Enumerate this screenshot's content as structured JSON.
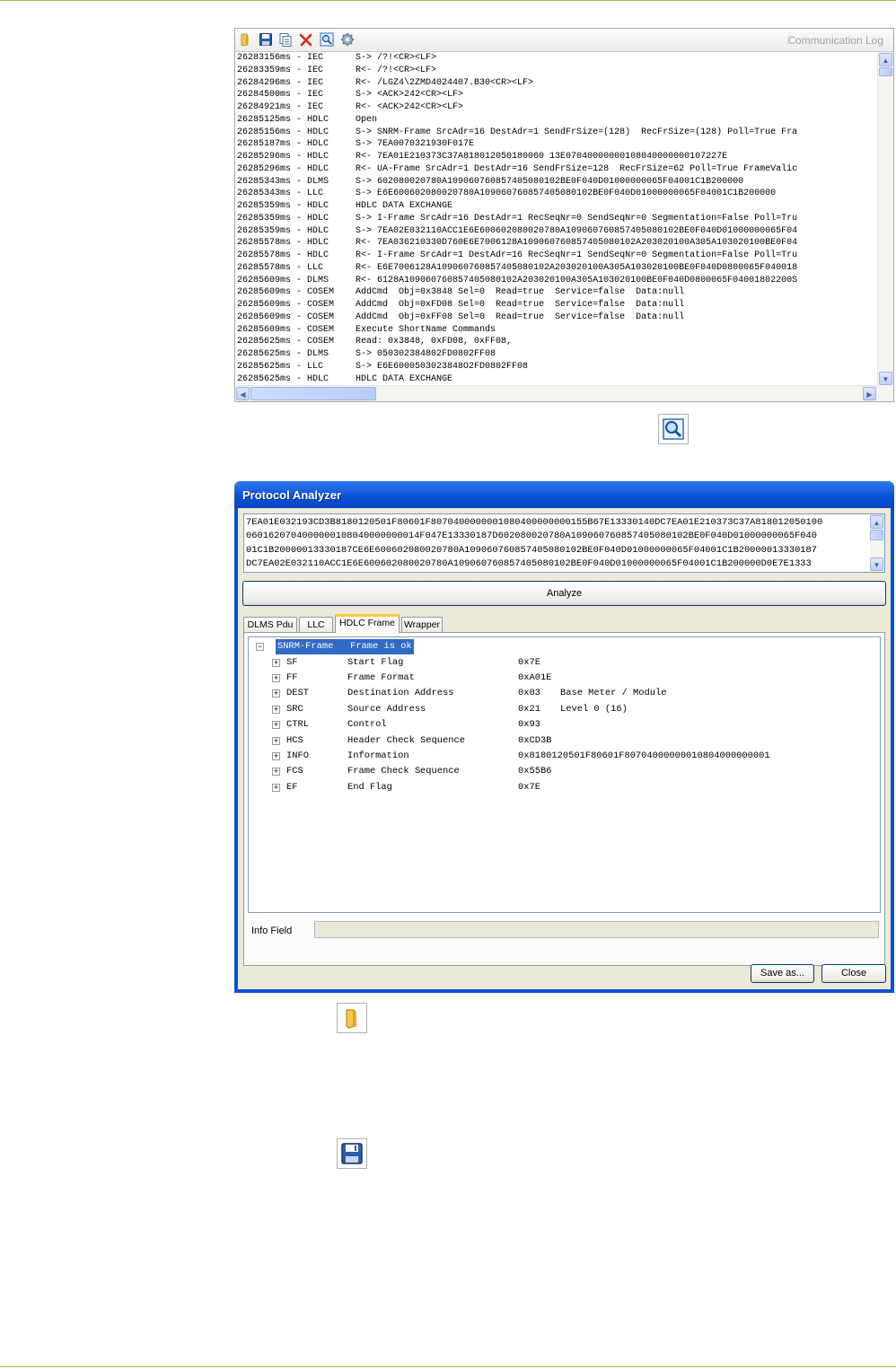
{
  "comm_log": {
    "title": "Communication Log",
    "toolbar_icons": [
      "open-folder-icon",
      "save-icon",
      "copy-icon",
      "delete-icon",
      "protocol-analyzer-icon",
      "settings-icon"
    ],
    "lines": [
      "26283156ms - IEC      S-> /?!<CR><LF>",
      "26283359ms - IEC      R<- /?!<CR><LF>",
      "26284296ms - IEC      R<- /LGZ4\\2ZMD4024407.B30<CR><LF>",
      "26284500ms - IEC      S-> <ACK>242<CR><LF>",
      "26284921ms - IEC      R<- <ACK>242<CR><LF>",
      "26285125ms - HDLC     Open",
      "26285156ms - HDLC     S-> SNRM-Frame SrcAdr=16 DestAdr=1 SendFrSize=(128)  RecFrSize=(128) Poll=True Fra",
      "26285187ms - HDLC     S-> 7EA0070321930F017E",
      "26285296ms - HDLC     R<- 7EA01E210373C37A818012050180060 13E07040000000108040000000107227E",
      "26285296ms - HDLC     R<- UA-Frame SrcAdr=1 DestAdr=16 SendFrSize=128  RecFrSize=62 Poll=True FrameValic",
      "26285343ms - DLMS     S-> 602080020780A109060760857405080102BE0F040D01000000065F04001C1B200000",
      "26285343ms - LLC      S-> E6E600602080020780A109060760857405080102BE0F040D01000000065F04001C1B200000",
      "26285359ms - HDLC     HDLC DATA EXCHANGE",
      "26285359ms - HDLC     S-> I-Frame SrcAdr=16 DestAdr=1 RecSeqNr=0 SendSeqNr=0 Segmentation=False Poll=Tru",
      "26285359ms - HDLC     S-> 7EA02E032110ACC1E6E600602080020780A109060760857405080102BE0F040D01000000065F04",
      "26285578ms - HDLC     R<- 7EA036210330D760E6E7006128A109060760857405080102A203020100A305A103020100BE0F04",
      "26285578ms - HDLC     R<- I-Frame SrcAdr=1 DestAdr=16 RecSeqNr=1 SendSeqNr=0 Segmentation=False Poll=Tru",
      "26285578ms - LLC      R<- E6E7006128A109060760857405080102A203020100A305A103020100BE0F040D0800065F040018",
      "26285609ms - DLMS     R<- 6128A109060760857405080102A203020100A305A103020100BE0F040D0800065F04001802200S",
      "26285609ms - COSEM    AddCmd  Obj=0x3848 Sel=0  Read=true  Service=false  Data:null",
      "26285609ms - COSEM    AddCmd  Obj=0xFD08 Sel=0  Read=true  Service=false  Data:null",
      "26285609ms - COSEM    AddCmd  Obj=0xFF08 Sel=0  Read=true  Service=false  Data:null",
      "26285609ms - COSEM    Execute ShortName Commands",
      "26285625ms - COSEM    Read: 0x3848, 0xFD08, 0xFF08,",
      "26285625ms - DLMS     S-> 050302384802FD0802FF08",
      "26285625ms - LLC      S-> E6E6000503023848O2FD0802FF08",
      "26285625ms - HDLC     HDLC DATA EXCHANGE"
    ]
  },
  "protocol_analyzer": {
    "title": "Protocol Analyzer",
    "hex_lines": [
      "7EA01E032193CD3B8180120501F80601F8070400000001080400000000155B67E13330140DC7EA01E210373C37A818012050100",
      "0601620704000000108040000000014F047E13330187D602080020780A109060760857405080102BE0F040D01000000065F040",
      "01C1B20000013330187CE6E600602080020780A109060760857405080102BE0F040D01000000065F04001C1B20000013330187",
      "DC7EA02E032110ACC1E6E600602080020780A109060760857405080102BE0F040D01000000065F04001C1B200000D0E7E1333"
    ],
    "analyze_label": "Analyze",
    "tabs": [
      "DLMS Pdu",
      "LLC",
      "HDLC Frame",
      "Wrapper"
    ],
    "active_tab": "HDLC Frame",
    "tree_root": {
      "name": "SNRM-Frame",
      "status": "Frame is ok"
    },
    "tree_items": [
      {
        "key": "SF",
        "desc": "Start Flag",
        "value": "0x7E",
        "note": ""
      },
      {
        "key": "FF",
        "desc": "Frame Format",
        "value": "0xA01E",
        "note": ""
      },
      {
        "key": "DEST",
        "desc": "Destination Address",
        "value": "0x03",
        "note": "Base Meter / Module"
      },
      {
        "key": "SRC",
        "desc": "Source Address",
        "value": "0x21",
        "note": "Level 0 (16)"
      },
      {
        "key": "CTRL",
        "desc": "Control",
        "value": "0x93",
        "note": ""
      },
      {
        "key": "HCS",
        "desc": "Header Check Sequence",
        "value": "0xCD3B",
        "note": ""
      },
      {
        "key": "INFO",
        "desc": "Information",
        "value": "0x8180120501F80601F80704000000010804000000001",
        "note": ""
      },
      {
        "key": "FCS",
        "desc": "Frame Check Sequence",
        "value": "0x55B6",
        "note": ""
      },
      {
        "key": "EF",
        "desc": "End Flag",
        "value": "0x7E",
        "note": ""
      }
    ],
    "info_label": "Info Field",
    "info_value": "",
    "save_label": "Save as...",
    "close_label": "Close"
  },
  "icons": {
    "between_panels": "protocol-analyzer-icon",
    "open_icon": "open-folder-icon",
    "save_icon": "save-icon"
  },
  "colors": {
    "accent_rule": "#8dc63f",
    "titlebar": "#0a4fd4",
    "selection": "#316ac5",
    "active_tab_highlight": "#ffc83c"
  }
}
